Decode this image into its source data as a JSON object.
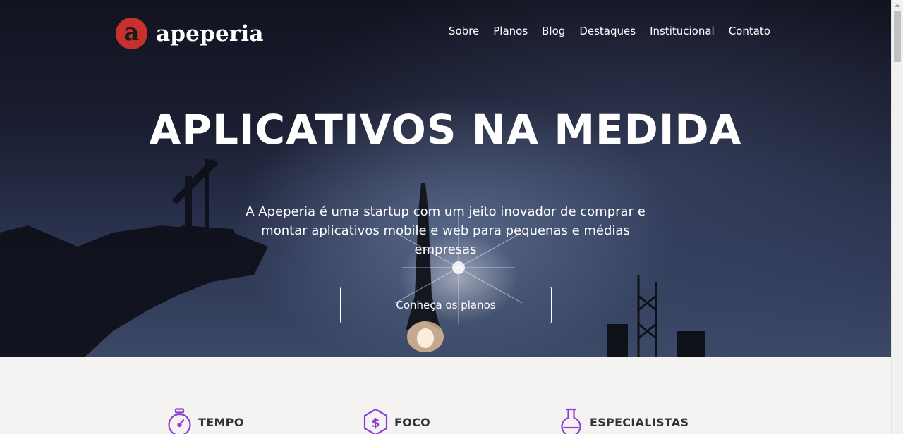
{
  "brand": {
    "logo_letter": "a",
    "name": "apeperia",
    "accent": "#c8302c"
  },
  "nav": {
    "items": [
      "Sobre",
      "Planos",
      "Blog",
      "Destaques",
      "Institucional",
      "Contato"
    ]
  },
  "hero": {
    "title": "APLICATIVOS NA MEDIDA",
    "subtitle": "A Apeperia é uma startup com um jeito inovador de comprar e montar aplicativos mobile e web para pequenas e médias empresas",
    "cta_label": "Conheça os planos"
  },
  "features": {
    "icon_color": "#8e3fd3",
    "items": [
      {
        "label": "TEMPO",
        "icon": "stopwatch-icon"
      },
      {
        "label": "FOCO",
        "icon": "dollar-hexagon-icon"
      },
      {
        "label": "ESPECIALISTAS",
        "icon": "flask-icon"
      }
    ]
  }
}
